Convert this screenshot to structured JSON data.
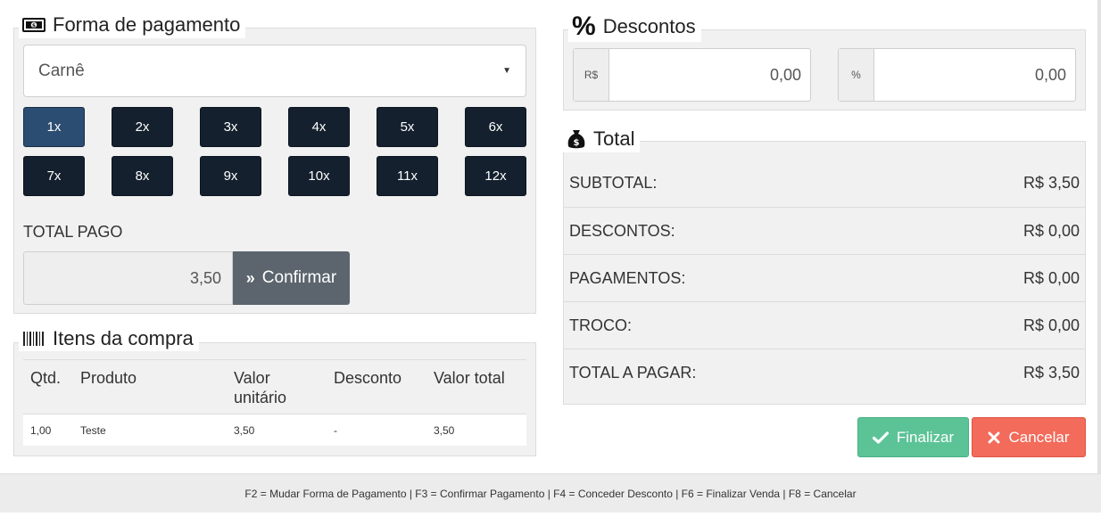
{
  "payment": {
    "title": "Forma de pagamento",
    "selected_method": "Carnê",
    "installments": [
      "1x",
      "2x",
      "3x",
      "4x",
      "5x",
      "6x",
      "7x",
      "8x",
      "9x",
      "10x",
      "11x",
      "12x"
    ],
    "active_installment": "1x",
    "total_pago_label": "TOTAL PAGO",
    "total_pago_value": "3,50",
    "confirm_label": "Confirmar"
  },
  "items": {
    "title": "Itens da compra",
    "headers": {
      "qtd": "Qtd.",
      "produto": "Produto",
      "valor_unitario_1": "Valor",
      "valor_unitario_2": "unitário",
      "desconto": "Desconto",
      "valor_total": "Valor total"
    },
    "rows": [
      {
        "qtd": "1,00",
        "produto": "Teste",
        "valor_unitario": "3,50",
        "desconto": "-",
        "valor_total": "3,50"
      }
    ]
  },
  "discounts": {
    "title": "Descontos",
    "currency_addon": "R$",
    "currency_value": "0,00",
    "percent_addon": "%",
    "percent_value": "0,00"
  },
  "totals": {
    "title": "Total",
    "rows": [
      {
        "label": "SUBTOTAL:",
        "value": "R$ 3,50"
      },
      {
        "label": "DESCONTOS:",
        "value": "R$ 0,00"
      },
      {
        "label": "PAGAMENTOS:",
        "value": "R$ 0,00"
      },
      {
        "label": "TROCO:",
        "value": "R$ 0,00"
      },
      {
        "label": "TOTAL A PAGAR:",
        "value": "R$ 3,50"
      }
    ]
  },
  "actions": {
    "finalizar_label": "Finalizar",
    "cancelar_label": "Cancelar"
  },
  "footer": {
    "shortcuts": "F2 = Mudar Forma de Pagamento | F3 = Confirmar Pagamento | F4 = Conceder Desconto | F6 = Finalizar Venda | F8 = Cancelar"
  },
  "colors": {
    "installment_bg": "#14202e",
    "installment_active_bg": "#2c4d72",
    "confirm_bg": "#5c656d",
    "finalizar_bg": "#5cc397",
    "cancelar_bg": "#f26b5b"
  }
}
